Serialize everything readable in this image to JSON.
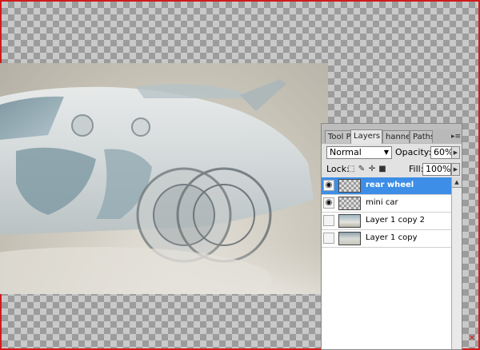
{
  "panel": {
    "tabs": [
      {
        "label": "Tool Pr"
      },
      {
        "label": "Layers",
        "close": "×"
      },
      {
        "label": "hannels"
      },
      {
        "label": "Paths"
      }
    ],
    "menu_icon": "panel-menu-icon"
  },
  "blend_mode": {
    "value": "Normal"
  },
  "opacity": {
    "label": "Opacity:",
    "value": "60%"
  },
  "lock": {
    "label": "Lock:",
    "icons": [
      "lock-transparent-icon",
      "lock-paint-icon",
      "lock-move-icon",
      "lock-all-icon"
    ]
  },
  "fill": {
    "label": "Fill:",
    "value": "100%"
  },
  "layers": [
    {
      "name": "rear wheel",
      "visible": true,
      "selected": true,
      "thumb": "checker"
    },
    {
      "name": "mini car",
      "visible": true,
      "selected": false,
      "thumb": "checker"
    },
    {
      "name": "Layer 1 copy 2",
      "visible": false,
      "selected": false,
      "thumb": "car"
    },
    {
      "name": "Layer 1 copy",
      "visible": false,
      "selected": false,
      "thumb": "small"
    }
  ],
  "colors": {
    "selection": "#3d8ee6",
    "frame_border": "#d21a1a"
  }
}
